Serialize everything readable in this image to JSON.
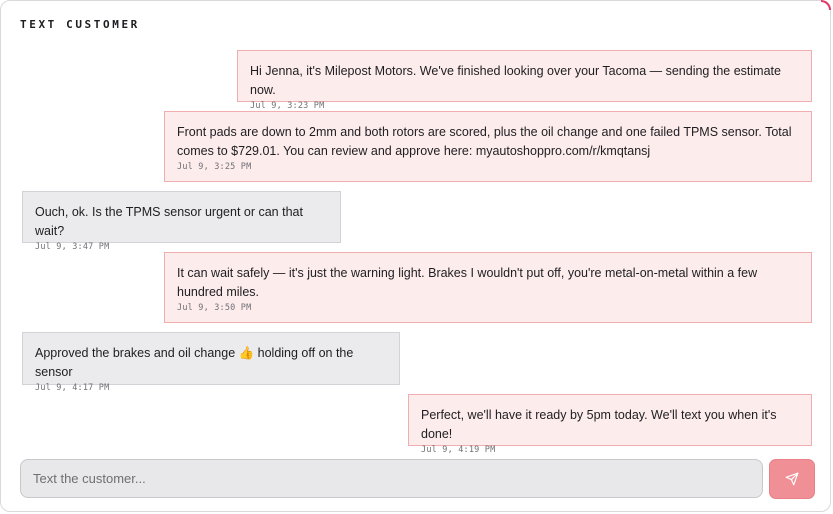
{
  "header": {
    "title": "TEXT CUSTOMER"
  },
  "messages": [
    {
      "direction": "outgoing",
      "text": "Hi Jenna, it's Milepost Motors. We've finished looking over your Tacoma — sending the estimate now.",
      "time": "Jul 9, 3:23 PM"
    },
    {
      "direction": "outgoing",
      "text": "Front pads are down to 2mm and both rotors are scored, plus the oil change and one failed TPMS sensor. Total comes to $729.01. You can review and approve here: myautoshoppro.com/r/kmqtansj",
      "time": "Jul 9, 3:25 PM"
    },
    {
      "direction": "incoming",
      "text": "Ouch, ok. Is the TPMS sensor urgent or can that wait?",
      "time": "Jul 9, 3:47 PM"
    },
    {
      "direction": "outgoing",
      "text": "It can wait safely — it's just the warning light. Brakes I wouldn't put off, you're metal-on-metal within a few hundred miles.",
      "time": "Jul 9, 3:50 PM"
    },
    {
      "direction": "incoming",
      "text": "Approved the brakes and oil change 👍 holding off on the sensor",
      "time": "Jul 9, 4:17 PM"
    },
    {
      "direction": "outgoing",
      "text": "Perfect, we'll have it ready by 5pm today. We'll text you when it's done!",
      "time": "Jul 9, 4:19 PM"
    }
  ],
  "composer": {
    "value": "",
    "placeholder": "Text the customer..."
  },
  "send_button": {
    "icon": "send-icon"
  },
  "colors": {
    "outgoing_bubble_bg": "#fdecec",
    "outgoing_bubble_border": "#f1aeb0",
    "incoming_bubble_bg": "#ebebed",
    "incoming_bubble_border": "#d3d3d7",
    "send_button_bg": "#f08f95",
    "accent": "#e2245c"
  }
}
